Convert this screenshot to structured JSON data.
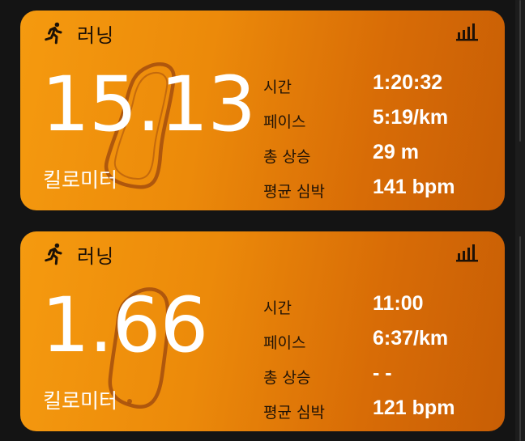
{
  "cards": [
    {
      "activity": "러닝",
      "distance": "15.13",
      "distance_unit": "킬로미터",
      "metrics": [
        {
          "label": "시간",
          "value": "1:20:32"
        },
        {
          "label": "페이스",
          "value": "5:19/km"
        },
        {
          "label": "총 상승",
          "value": "29 m"
        },
        {
          "label": "평균 심박",
          "value": "141 bpm"
        }
      ]
    },
    {
      "activity": "러닝",
      "distance": "1.66",
      "distance_unit": "킬로미터",
      "metrics": [
        {
          "label": "시간",
          "value": "11:00"
        },
        {
          "label": "페이스",
          "value": "6:37/km"
        },
        {
          "label": "총 상승",
          "value": "- -"
        },
        {
          "label": "평균 심박",
          "value": "121 bpm"
        }
      ]
    }
  ],
  "colors": {
    "card_gradient_start": "#f59a0f",
    "card_gradient_end": "#c85e05",
    "label_text": "#1d1106",
    "value_text": "#ffffff",
    "background": "#141414"
  },
  "icons": {
    "activity": "running-person-icon",
    "stats": "bar-chart-icon"
  }
}
